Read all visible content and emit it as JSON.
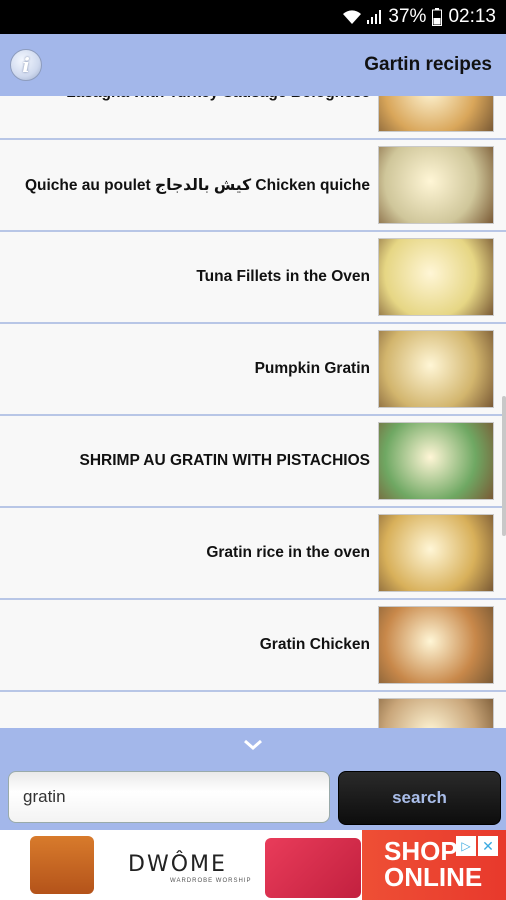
{
  "status_bar": {
    "battery_percent": "37%",
    "time": "02:13",
    "icons": [
      "wifi-icon",
      "signal-icon",
      "battery-icon"
    ]
  },
  "app_bar": {
    "title": "Gartin recipes",
    "info_icon": "info-icon"
  },
  "recipes": [
    {
      "title": "Lasagna with Turkey Sausage Bolognese",
      "thumb_color": "#d9a65a"
    },
    {
      "title": "Quiche au poulet كيش بالدجاج Chicken quiche",
      "thumb_color": "#cfc69a"
    },
    {
      "title": "Tuna Fillets in the Oven",
      "thumb_color": "#e6d684"
    },
    {
      "title": "Pumpkin Gratin",
      "thumb_color": "#d2b56d"
    },
    {
      "title": "SHRIMP AU GRATIN WITH PISTACHIOS",
      "thumb_color": "#6fa863"
    },
    {
      "title": "Gratin rice in the oven",
      "thumb_color": "#d8b05a"
    },
    {
      "title": "Gratin Chicken",
      "thumb_color": "#c8884a"
    },
    {
      "title": "",
      "thumb_color": "#c9a67a"
    }
  ],
  "search": {
    "value": "gratin",
    "button_label": "search"
  },
  "ad": {
    "brand": "DWÔME",
    "sub": "WARDROBE WORSHIP",
    "headline_1": "SHOP",
    "headline_2": "ONLINE"
  },
  "colors": {
    "accent": "#a3b7ea",
    "divider": "#b8c6e6",
    "search_text": "#a9bde9"
  }
}
